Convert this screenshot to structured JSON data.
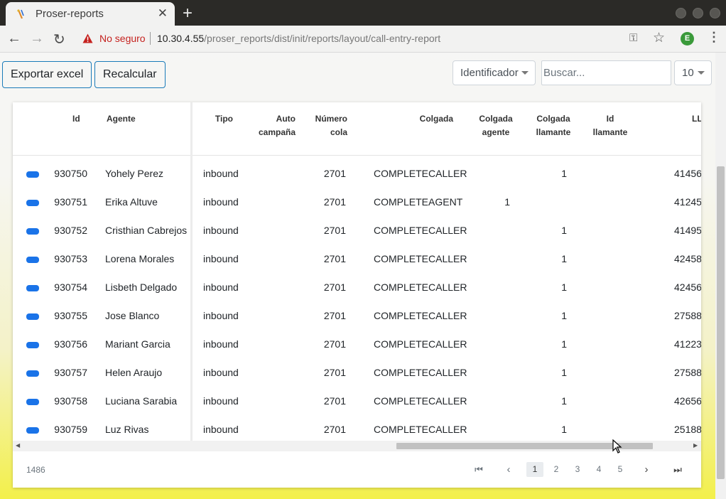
{
  "browser": {
    "tab_title": "Proser-reports",
    "tab_close": "✕",
    "new_tab": "+",
    "not_secure": "No seguro",
    "url_host": "10.30.4.55",
    "url_path": "/proser_reports/dist/init/reports/layout/call-entry-report",
    "profile_initial": "E"
  },
  "toolbar": {
    "export_label": "Exportar excel",
    "recalc_label": "Recalcular",
    "filter_select": "Identificador",
    "search_placeholder": "Buscar...",
    "page_size": "10"
  },
  "table": {
    "headers": {
      "id": "Id",
      "agent": "Agente",
      "type": "Tipo",
      "auto1": "Auto",
      "auto2": "campaña",
      "queue1": "Número",
      "queue2": "cola",
      "hangup": "Colgada",
      "hangup_agent1": "Colgada",
      "hangup_agent2": "agente",
      "hangup_caller1": "Colgada",
      "hangup_caller2": "llamante",
      "caller_id1": "Id",
      "caller_id2": "llamante",
      "next": "LL"
    },
    "rows": [
      {
        "id": "930750",
        "agent": "Yohely Perez",
        "type": "inbound",
        "queue": "2701",
        "hangup": "COMPLETECALLER",
        "hangup_agent": "",
        "hangup_caller": "1",
        "extra": "41456"
      },
      {
        "id": "930751",
        "agent": "Erika Altuve",
        "type": "inbound",
        "queue": "2701",
        "hangup": "COMPLETEAGENT",
        "hangup_agent": "1",
        "hangup_caller": "",
        "extra": "41245"
      },
      {
        "id": "930752",
        "agent": "Cristhian Cabrejos",
        "type": "inbound",
        "queue": "2701",
        "hangup": "COMPLETECALLER",
        "hangup_agent": "",
        "hangup_caller": "1",
        "extra": "41495"
      },
      {
        "id": "930753",
        "agent": "Lorena Morales",
        "type": "inbound",
        "queue": "2701",
        "hangup": "COMPLETECALLER",
        "hangup_agent": "",
        "hangup_caller": "1",
        "extra": "42458"
      },
      {
        "id": "930754",
        "agent": "Lisbeth Delgado",
        "type": "inbound",
        "queue": "2701",
        "hangup": "COMPLETECALLER",
        "hangup_agent": "",
        "hangup_caller": "1",
        "extra": "42456"
      },
      {
        "id": "930755",
        "agent": "Jose Blanco",
        "type": "inbound",
        "queue": "2701",
        "hangup": "COMPLETECALLER",
        "hangup_agent": "",
        "hangup_caller": "1",
        "extra": "27588"
      },
      {
        "id": "930756",
        "agent": "Mariant Garcia",
        "type": "inbound",
        "queue": "2701",
        "hangup": "COMPLETECALLER",
        "hangup_agent": "",
        "hangup_caller": "1",
        "extra": "41223"
      },
      {
        "id": "930757",
        "agent": "Helen Araujo",
        "type": "inbound",
        "queue": "2701",
        "hangup": "COMPLETECALLER",
        "hangup_agent": "",
        "hangup_caller": "1",
        "extra": "27588"
      },
      {
        "id": "930758",
        "agent": "Luciana Sarabia",
        "type": "inbound",
        "queue": "2701",
        "hangup": "COMPLETECALLER",
        "hangup_agent": "",
        "hangup_caller": "1",
        "extra": "42656"
      },
      {
        "id": "930759",
        "agent": "Luz Rivas",
        "type": "inbound",
        "queue": "2701",
        "hangup": "COMPLETECALLER",
        "hangup_agent": "",
        "hangup_caller": "1",
        "extra": "25188"
      }
    ]
  },
  "pagination": {
    "total": "1486",
    "pages": [
      "1",
      "2",
      "3",
      "4",
      "5"
    ],
    "active_page": "1"
  },
  "colors": {
    "accent": "#1a73e8",
    "button_border": "#1a7bb9",
    "not_secure": "#c5221f"
  }
}
